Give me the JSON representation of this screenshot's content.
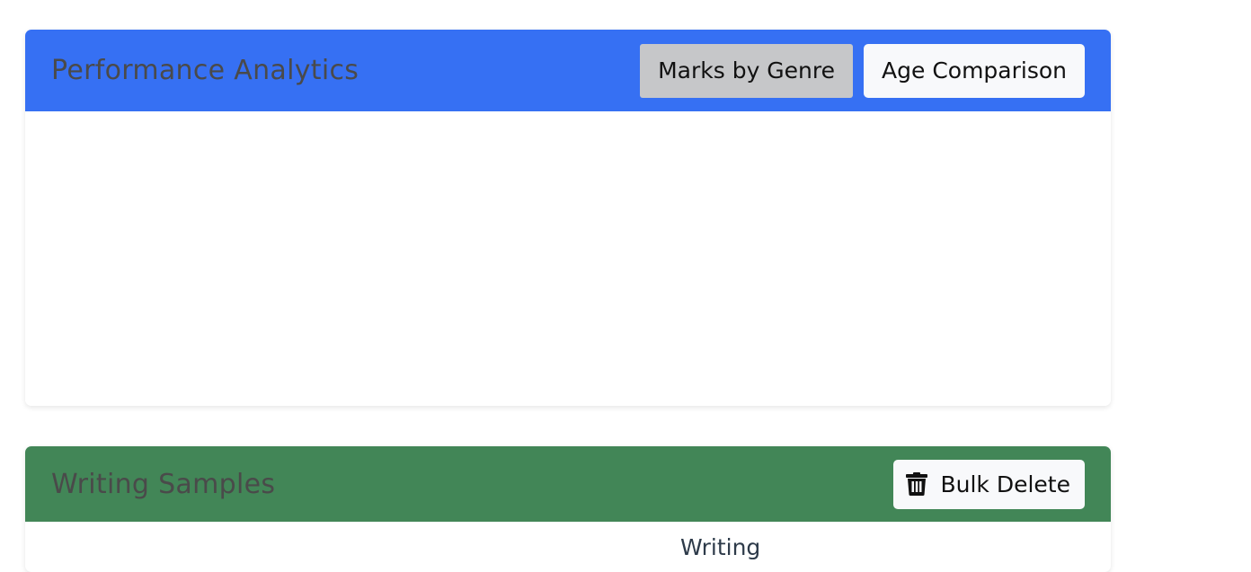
{
  "analytics": {
    "title": "Performance Analytics",
    "buttons": {
      "marks_by_genre": "Marks by Genre",
      "age_comparison": "Age Comparison"
    },
    "active_tab": "marks_by_genre"
  },
  "samples": {
    "title": "Writing Samples",
    "bulk_delete_label": "Bulk Delete",
    "column_header": "Writing"
  },
  "colors": {
    "analytics_header": "#3670f3",
    "samples_header": "#428657",
    "active_button": "#c6c7c9"
  },
  "icons": {
    "bulk_delete": "trash-icon"
  }
}
